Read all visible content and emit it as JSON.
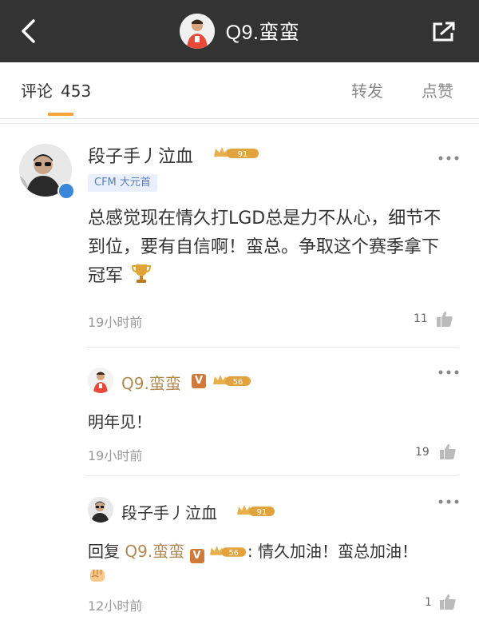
{
  "header": {
    "title": "Q9.蛮蛮",
    "back_icon": "chevron-left-icon",
    "share_icon": "share-external-icon",
    "bg_color": "#333333"
  },
  "tabs": {
    "comment_label": "评论",
    "comment_count": "453",
    "forward_label": "转发",
    "like_label": "点赞",
    "accent_color": "#f7a53b"
  },
  "comment": {
    "author": "段子手丿泣血",
    "level_badge": "91",
    "tag": "CFM 大元首",
    "text": "总感觉现在情久打LGD总是力不从心，细节不到位，要有自信啊！蛮总。争取这个赛季拿下冠军",
    "emoji_icon": "trophy-icon",
    "time": "19小时前",
    "likes": "11"
  },
  "replies": [
    {
      "author": "Q9.蛮蛮",
      "vip": "V",
      "level_badge": "56",
      "text": "明年见！",
      "time": "19小时前",
      "likes": "19"
    },
    {
      "author": "段子手丿泣血",
      "level_badge": "91",
      "reply_prefix": "回复",
      "reply_to": "Q9.蛮蛮",
      "reply_to_vip": "V",
      "reply_to_level": "56",
      "text": ": 情久加油！蛮总加油！",
      "emoji_icon": "fist-icon",
      "time": "12小时前",
      "likes": "1"
    }
  ]
}
